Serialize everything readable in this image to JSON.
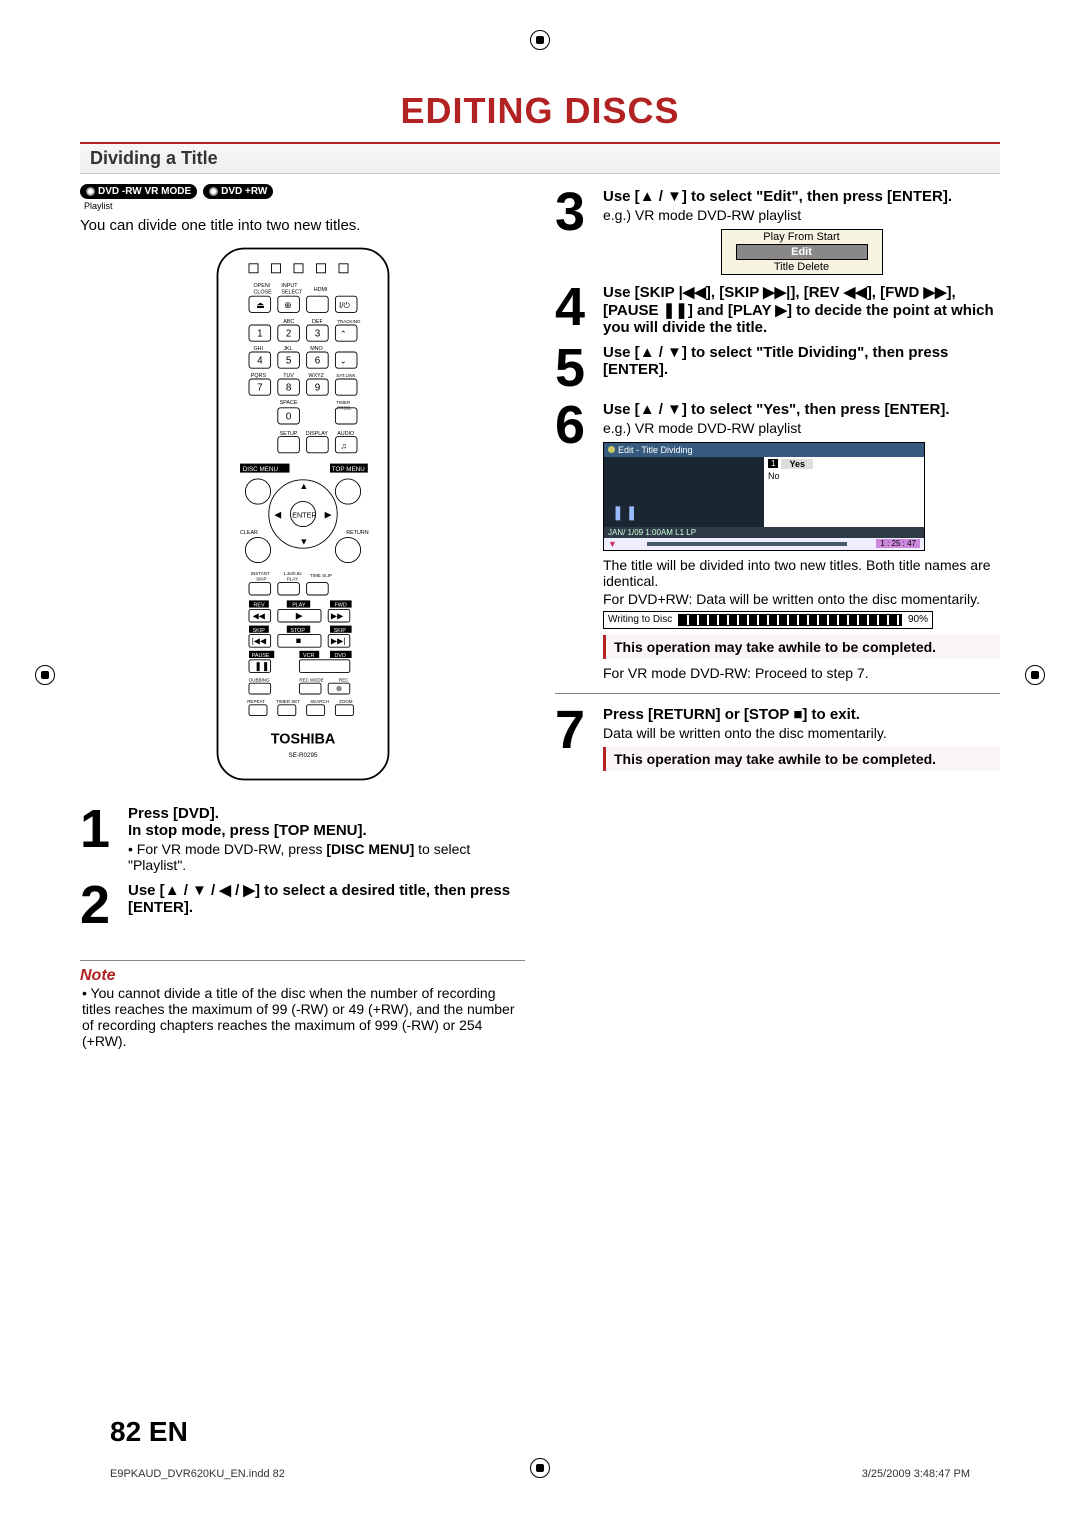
{
  "header": {
    "title": "EDITING DISCS"
  },
  "section": {
    "label": "Dividing a Title"
  },
  "badges": {
    "rw_vr": "DVD -RW VR MODE",
    "plus_rw": "DVD +RW",
    "playlist": "Playlist"
  },
  "intro": "You can divide one title into two new titles.",
  "remote": {
    "brand": "TOSHIBA",
    "model": "SE-R0295",
    "labels": {
      "open_close": "OPEN/CLOSE",
      "input_select": "INPUT SELECT",
      "hdmi": "HDMI",
      "abc": "ABC",
      "def": "DEF",
      "ghi": "GHI",
      "jkl": "JKL",
      "mno": "MNO",
      "pqrs": "PQRS",
      "tuv": "TUV",
      "wxyz": "WXYZ",
      "space": "SPACE",
      "tracking": "TRACKING",
      "sat_link": "SAT.LINK",
      "timer_prog": "TIMER PROG.",
      "setup": "SETUP",
      "display": "DISPLAY",
      "audio": "AUDIO",
      "disc_menu": "DISC MENU",
      "top_menu": "TOP MENU",
      "enter": "ENTER",
      "clear": "CLEAR",
      "return": "RETURN",
      "instant_skip": "INSTANT SKIP",
      "x_play": "1.3x/0.8x PLAY",
      "time_slip": "TIME SLIP",
      "rev": "REV",
      "play": "PLAY",
      "fwd": "FWD",
      "skip_l": "SKIP",
      "stop": "STOP",
      "skip_r": "SKIP",
      "pause": "PAUSE",
      "vcr": "VCR",
      "dvd": "DVD",
      "dubbing": "DUBBING",
      "rec_mode": "REC MODE",
      "rec": "REC",
      "repeat": "REPEAT",
      "timer_set": "TIMER SET",
      "search": "SEARCH",
      "zoom": "ZOOM"
    }
  },
  "steps": {
    "s1": {
      "num": "1",
      "bold1": "Press [DVD].",
      "bold2": "In stop mode, press [TOP MENU].",
      "bullet_prefix": "• For VR mode DVD-RW, press ",
      "bullet_bold": "[DISC MENU]",
      "bullet_suffix": " to select \"Playlist\"."
    },
    "s2": {
      "num": "2",
      "text_pre": "Use [",
      "text_mid": "] to select a desired title, then press [ENTER].",
      "arrows": "▲ / ▼ / ◀ / ▶"
    },
    "s3": {
      "num": "3",
      "text_pre": "Use [",
      "arrows": "▲ / ▼",
      "text_post": "] to select \"Edit\", then press [ENTER].",
      "eg": "e.g.) VR mode DVD-RW playlist",
      "menu": {
        "play": "Play From Start",
        "edit": "Edit",
        "del": "Title Delete"
      }
    },
    "s4": {
      "num": "4",
      "line1_pre": "Use [SKIP ",
      "line1_mid1": "], [SKIP ",
      "line1_mid2": "], [REV ",
      "line1_mid3": "], [FWD ",
      "line1_mid4": "], [PAUSE ",
      "line1_mid5": "] and [PLAY ",
      "line1_post": "] to decide the point at which you will divide the title."
    },
    "s5": {
      "num": "5",
      "text_pre": "Use [",
      "arrows": "▲ / ▼",
      "text_post": "] to select \"Title Dividing\", then press [ENTER]."
    },
    "s6": {
      "num": "6",
      "text_pre": "Use [",
      "arrows": "▲ / ▼",
      "text_post": "] to select \"Yes\", then press [ENTER].",
      "eg": "e.g.) VR mode DVD-RW playlist",
      "screen": {
        "header": "Edit - Title Dividing",
        "index": "1",
        "yes": "Yes",
        "no": "No",
        "footer1": "JAN/ 1/09 1:00AM L1   LP",
        "time": "1 : 25 : 47"
      },
      "note1": "The title will be divided into two new titles. Both title names are identical.",
      "note2": "For DVD+RW: Data will be written onto the disc momentarily.",
      "writing": {
        "label": "Writing to Disc",
        "pct": "90%"
      },
      "callout": "This operation may take awhile to be completed.",
      "note3": "For VR mode DVD-RW: Proceed to step 7."
    },
    "s7": {
      "num": "7",
      "text_pre": "Press [RETURN] or [STOP ",
      "text_post": "] to exit.",
      "note": "Data will be written onto the disc momentarily.",
      "callout": "This operation may take awhile to be completed."
    }
  },
  "note_section": {
    "label": "Note",
    "body": "• You cannot divide a title of the disc when the number of recording titles reaches the maximum of 99 (-RW) or 49 (+RW), and the number of recording chapters reaches the maximum of 999 (-RW) or 254 (+RW)."
  },
  "pagefoot": {
    "num": "82 EN",
    "left": "E9PKAUD_DVR620KU_EN.indd   82",
    "right": "3/25/2009   3:48:47 PM"
  }
}
